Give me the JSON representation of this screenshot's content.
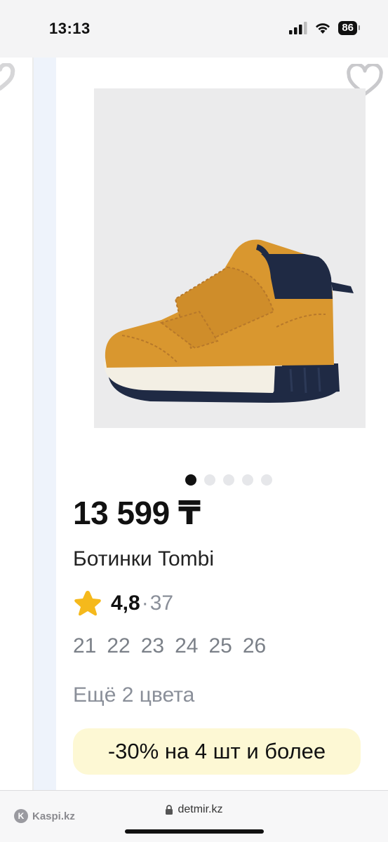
{
  "status_bar": {
    "time": "13:13",
    "battery": "86",
    "icons": [
      "cellular-signal-icon",
      "wifi-icon",
      "battery-icon"
    ]
  },
  "product": {
    "price": "13 599 ₸",
    "title": "Ботинки Tombi",
    "rating": "4,8",
    "rating_separator": "·",
    "reviews_count": "37",
    "sizes": [
      "21",
      "22",
      "23",
      "24",
      "25",
      "26"
    ],
    "more_colors": "Ещё 2 цвета",
    "promo": "-30% на 4 шт и более",
    "image_count": 5,
    "active_image_index": 0
  },
  "browser": {
    "source_label": "Kaspi.kz",
    "url": "detmir.kz"
  },
  "colors": {
    "accent_star": "#f5b91c",
    "promo_background": "#fdf8d4",
    "boot_body": "#d9972f",
    "boot_collar": "#1f2a44"
  }
}
